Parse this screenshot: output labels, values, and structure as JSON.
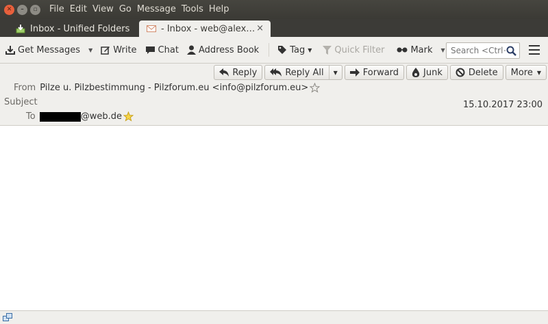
{
  "menu": [
    "File",
    "Edit",
    "View",
    "Go",
    "Message",
    "Tools",
    "Help"
  ],
  "tabs": [
    {
      "label": "Inbox - Unified Folders",
      "icon": "inbox-download-icon"
    },
    {
      "label": " - Inbox - web@alex…",
      "icon": "envelope-icon",
      "close": "×"
    }
  ],
  "toolbar": {
    "get_messages": "Get Messages",
    "write": "Write",
    "chat": "Chat",
    "address_book": "Address Book",
    "tag": "Tag",
    "quick_filter": "Quick Filter",
    "mark": "Mark",
    "search_placeholder": "Search <Ctrl+K>"
  },
  "header_buttons": {
    "reply": "Reply",
    "reply_all": "Reply All",
    "forward": "Forward",
    "junk": "Junk",
    "delete": "Delete",
    "more": "More"
  },
  "message": {
    "from_label": "From",
    "from_value": "Pilze u. Pilzbestimmung - Pilzforum.eu <info@pilzforum.eu>",
    "subject_label": "Subject",
    "date": "15.10.2017 23:00",
    "to_label": "To",
    "to_value": "@web.de"
  },
  "colors": {
    "titlebar": "#3c3b37",
    "close_button": "#e8603c",
    "toolbar_bg": "#f0efec"
  }
}
